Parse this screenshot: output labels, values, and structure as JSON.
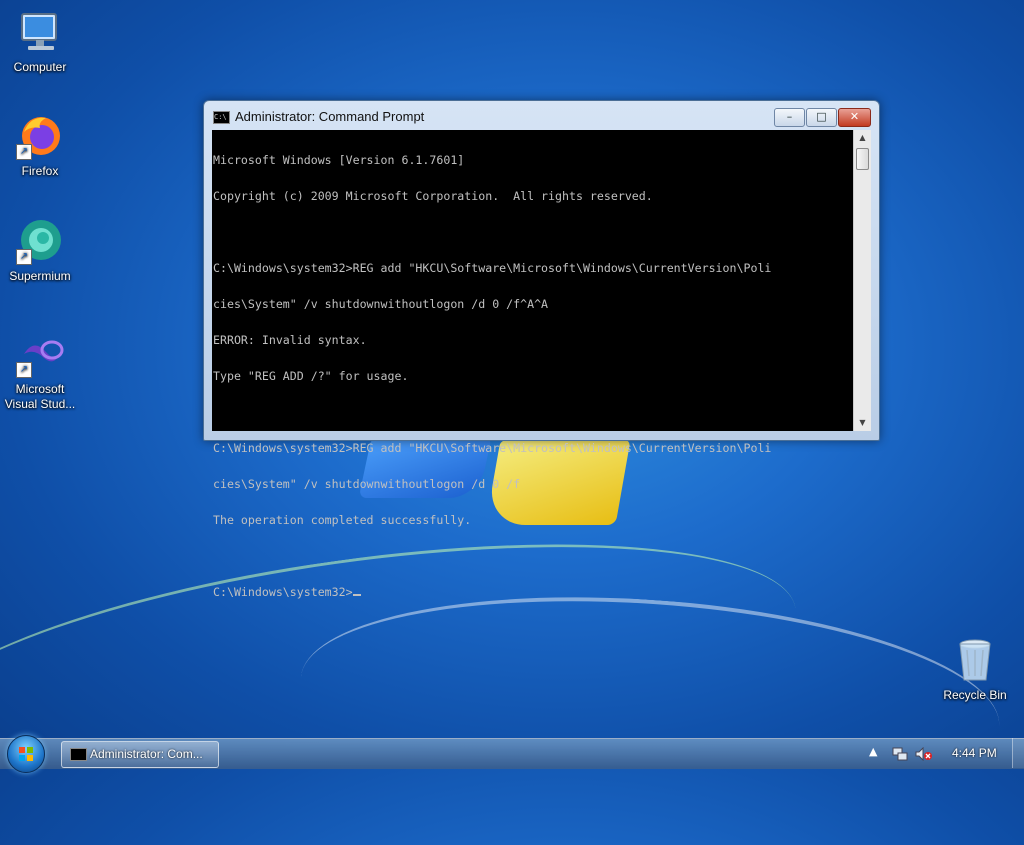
{
  "desktop": {
    "icons": [
      {
        "label": "Computer",
        "icon": "computer-icon"
      },
      {
        "label": "Firefox",
        "icon": "firefox-icon"
      },
      {
        "label": "Supermium",
        "icon": "supermium-icon"
      },
      {
        "label": "Microsoft\nVisual Stud...",
        "icon": "visual-studio-icon"
      },
      {
        "label": "Recycle Bin",
        "icon": "recycle-bin-icon"
      }
    ]
  },
  "cmd_window": {
    "title": "Administrator: Command Prompt",
    "buttons": {
      "minimize": "–",
      "maximize": "□",
      "close": "✕"
    },
    "lines": [
      "Microsoft Windows [Version 6.1.7601]",
      "Copyright (c) 2009 Microsoft Corporation.  All rights reserved.",
      "",
      "C:\\Windows\\system32>REG add \"HKCU\\Software\\Microsoft\\Windows\\CurrentVersion\\Poli",
      "cies\\System\" /v shutdownwithoutlogon /d 0 /f^A^A",
      "ERROR: Invalid syntax.",
      "Type \"REG ADD /?\" for usage.",
      "",
      "C:\\Windows\\system32>REG add \"HKCU\\Software\\Microsoft\\Windows\\CurrentVersion\\Poli",
      "cies\\System\" /v shutdownwithoutlogon /d 0 /f",
      "The operation completed successfully.",
      "",
      "C:\\Windows\\system32>"
    ]
  },
  "taskbar": {
    "task_label": "Administrator: Com...",
    "clock": "4:44 PM",
    "tray_icons": [
      "show-hidden-icons-arrow",
      "network-icon",
      "volume-muted-icon"
    ]
  },
  "colors": {
    "console_bg": "#000000",
    "console_fg": "#c0c0c0",
    "desktop_bg": "#1d6ccc"
  }
}
